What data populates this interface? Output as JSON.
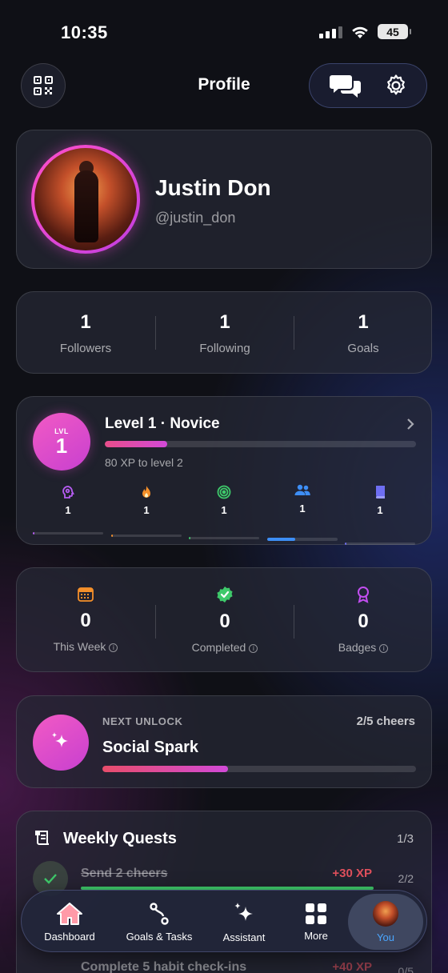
{
  "status_bar": {
    "time": "10:35",
    "battery": "45"
  },
  "header": {
    "title": "Profile"
  },
  "profile": {
    "name": "Justin Don",
    "handle": "@justin_don"
  },
  "social_stats": [
    {
      "value": "1",
      "label": "Followers"
    },
    {
      "value": "1",
      "label": "Following"
    },
    {
      "value": "1",
      "label": "Goals"
    }
  ],
  "level": {
    "badge_small": "LVL",
    "badge_number": "1",
    "title": "Level 1 · Novice",
    "xp_text": "80 XP to level 2",
    "progress": 0.2,
    "skills": [
      {
        "icon": "head-icon",
        "value": "1",
        "color": "#b65cf2",
        "progress": 0.02
      },
      {
        "icon": "flame-icon",
        "value": "1",
        "color": "#f5902a",
        "progress": 0.02
      },
      {
        "icon": "target-icon",
        "value": "1",
        "color": "#3ec96a",
        "progress": 0.02
      },
      {
        "icon": "people-icon",
        "value": "1",
        "color": "#3d8ef5",
        "progress": 0.4
      },
      {
        "icon": "book-icon",
        "value": "1",
        "color": "#6e6ef2",
        "progress": 0.02
      }
    ]
  },
  "summary_stats": [
    {
      "icon": "calendar-icon",
      "value": "0",
      "label": "This Week"
    },
    {
      "icon": "verified-check-icon",
      "value": "0",
      "label": "Completed"
    },
    {
      "icon": "badge-ribbon-icon",
      "value": "0",
      "label": "Badges"
    }
  ],
  "next_unlock": {
    "label": "NEXT UNLOCK",
    "count": "2/5 cheers",
    "title": "Social Spark",
    "progress": 0.4
  },
  "weekly_quests": {
    "title": "Weekly Quests",
    "count": "1/3",
    "items": [
      {
        "label": "Send 2 cheers",
        "xp": "+30 XP",
        "count": "2/2",
        "done": true,
        "progress": 1.0
      },
      {
        "label": "Complete 5 habit check-ins",
        "xp": "+40 XP",
        "count": "0/5",
        "done": false,
        "progress": 0
      }
    ]
  },
  "tabbar": {
    "items": [
      {
        "label": "Dashboard",
        "icon": "home-icon"
      },
      {
        "label": "Goals & Tasks",
        "icon": "path-icon"
      },
      {
        "label": "Assistant",
        "icon": "sparkles-icon"
      },
      {
        "label": "More",
        "icon": "grid-icon"
      },
      {
        "label": "You",
        "icon": "avatar-icon",
        "active": true
      }
    ]
  },
  "colors": {
    "accent_pink": "#f25ac4",
    "accent_blue": "#4aa6ff",
    "success_green": "#3ec96a",
    "xp_red": "#e0505c"
  }
}
